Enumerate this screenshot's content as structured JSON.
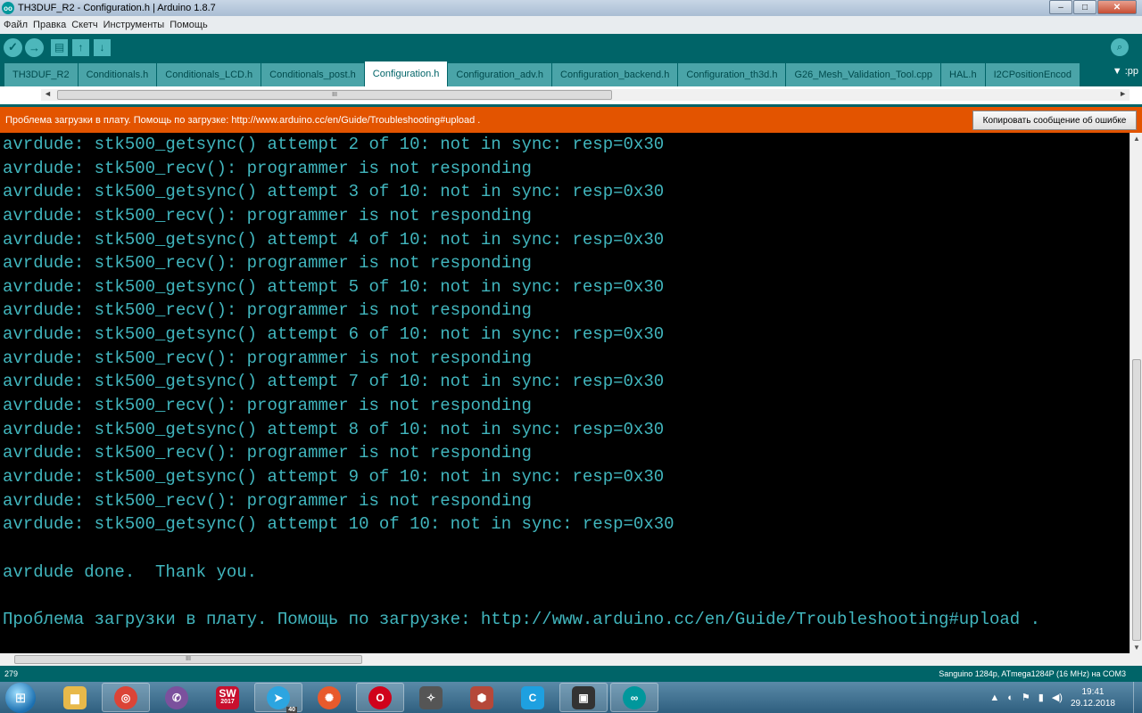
{
  "window": {
    "title": "TH3DUF_R2 - Configuration.h | Arduino 1.8.7",
    "logo_text": "oo",
    "controls": {
      "minimize": "‒",
      "maximize": "□",
      "close": "✕"
    }
  },
  "menu": [
    "Файл",
    "Правка",
    "Скетч",
    "Инструменты",
    "Помощь"
  ],
  "toolbar": {
    "verify": "✓",
    "upload": "→",
    "new": "▤",
    "open": "↑",
    "save": "↓",
    "serial_monitor": "⌕"
  },
  "tabs": [
    "TH3DUF_R2",
    "Conditionals.h",
    "Conditionals_LCD.h",
    "Conditionals_post.h",
    "Configuration.h",
    "Configuration_adv.h",
    "Configuration_backend.h",
    "Configuration_th3d.h",
    "G26_Mesh_Validation_Tool.cpp",
    "HAL.h",
    "I2CPositionEncod"
  ],
  "active_tab": "Configuration.h",
  "tab_menu": "▼ :pp",
  "editor_scroll": {
    "left_arrow": "◄",
    "right_arrow": "►",
    "thumb_grip": "III"
  },
  "error_bar": {
    "message": "Проблема загрузки в плату. Помощь по загрузке: http://www.arduino.cc/en/Guide/Troubleshooting#upload .",
    "copy_button": "Копировать сообщение об ошибке",
    "color": "#e35400"
  },
  "console": {
    "color": "#41b6be",
    "lines": [
      "avrdude: stk500_getsync() attempt 2 of 10: not in sync: resp=0x30",
      "avrdude: stk500_recv(): programmer is not responding",
      "avrdude: stk500_getsync() attempt 3 of 10: not in sync: resp=0x30",
      "avrdude: stk500_recv(): programmer is not responding",
      "avrdude: stk500_getsync() attempt 4 of 10: not in sync: resp=0x30",
      "avrdude: stk500_recv(): programmer is not responding",
      "avrdude: stk500_getsync() attempt 5 of 10: not in sync: resp=0x30",
      "avrdude: stk500_recv(): programmer is not responding",
      "avrdude: stk500_getsync() attempt 6 of 10: not in sync: resp=0x30",
      "avrdude: stk500_recv(): programmer is not responding",
      "avrdude: stk500_getsync() attempt 7 of 10: not in sync: resp=0x30",
      "avrdude: stk500_recv(): programmer is not responding",
      "avrdude: stk500_getsync() attempt 8 of 10: not in sync: resp=0x30",
      "avrdude: stk500_recv(): programmer is not responding",
      "avrdude: stk500_getsync() attempt 9 of 10: not in sync: resp=0x30",
      "avrdude: stk500_recv(): programmer is not responding",
      "avrdude: stk500_getsync() attempt 10 of 10: not in sync: resp=0x30",
      "",
      "avrdude done.  Thank you.",
      "",
      "Проблема загрузки в плату. Помощь по загрузке: http://www.arduino.cc/en/Guide/Troubleshooting#upload ."
    ]
  },
  "console_scroll": {
    "up_arrow": "▲",
    "down_arrow": "▼",
    "thumb_grip": "III"
  },
  "status": {
    "line_number": "279",
    "board": "Sanguino 1284p, ATmega1284P (16 MHz) на COM3"
  },
  "taskbar": {
    "start_icon": "⊞",
    "apps": [
      {
        "name": "explorer",
        "glyph": "▆",
        "color": "#e8b94a"
      },
      {
        "name": "chrome",
        "glyph": "◎",
        "color": "#db4437"
      },
      {
        "name": "viber",
        "glyph": "✆",
        "color": "#7b519d"
      },
      {
        "name": "solidworks",
        "glyph": "SW",
        "color": "#c8102e"
      },
      {
        "name": "telegram",
        "glyph": "➤",
        "color": "#2ca5e0"
      },
      {
        "name": "pinwheel-app",
        "glyph": "✺",
        "color": "#e85a2c"
      },
      {
        "name": "opera",
        "glyph": "O",
        "color": "#d0021b"
      },
      {
        "name": "inkscape",
        "glyph": "✧",
        "color": "#555555"
      },
      {
        "name": "3d-viewer",
        "glyph": "⬢",
        "color": "#b5483a"
      },
      {
        "name": "ccleaner",
        "glyph": "C",
        "color": "#1ea0e0"
      },
      {
        "name": "media-app",
        "glyph": "▣",
        "color": "#333333"
      },
      {
        "name": "arduino",
        "glyph": "∞",
        "color": "#00979c"
      }
    ],
    "telegram_badge": "40",
    "solidworks_year": "2017",
    "tray_icons": [
      "▲",
      "◐",
      "⚑",
      "▮",
      "◀)"
    ],
    "time": "19:41",
    "date": "29.12.2018"
  }
}
